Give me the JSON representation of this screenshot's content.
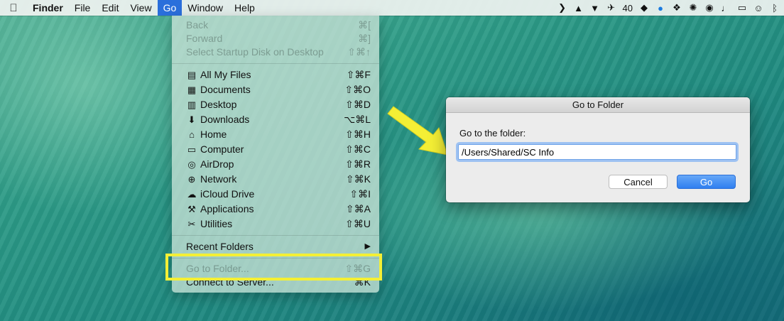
{
  "menubar": {
    "app_name": "Finder",
    "items": [
      "File",
      "Edit",
      "View",
      "Go",
      "Window",
      "Help"
    ],
    "active_item": "Go",
    "status_badge": "40"
  },
  "go_menu": {
    "nav_items": [
      {
        "label": "Back",
        "shortcut": "⌘[",
        "enabled": false
      },
      {
        "label": "Forward",
        "shortcut": "⌘]",
        "enabled": false
      },
      {
        "label": "Select Startup Disk on Desktop",
        "shortcut": "⇧⌘↑",
        "enabled": false
      }
    ],
    "location_items": [
      {
        "label": "All My Files",
        "shortcut": "⇧⌘F",
        "icon": "files-icon"
      },
      {
        "label": "Documents",
        "shortcut": "⇧⌘O",
        "icon": "documents-icon"
      },
      {
        "label": "Desktop",
        "shortcut": "⇧⌘D",
        "icon": "desktop-icon"
      },
      {
        "label": "Downloads",
        "shortcut": "⌥⌘L",
        "icon": "downloads-icon"
      },
      {
        "label": "Home",
        "shortcut": "⇧⌘H",
        "icon": "home-icon"
      },
      {
        "label": "Computer",
        "shortcut": "⇧⌘C",
        "icon": "computer-icon"
      },
      {
        "label": "AirDrop",
        "shortcut": "⇧⌘R",
        "icon": "airdrop-icon"
      },
      {
        "label": "Network",
        "shortcut": "⇧⌘K",
        "icon": "network-icon"
      },
      {
        "label": "iCloud Drive",
        "shortcut": "⇧⌘I",
        "icon": "cloud-icon"
      },
      {
        "label": "Applications",
        "shortcut": "⇧⌘A",
        "icon": "applications-icon"
      },
      {
        "label": "Utilities",
        "shortcut": "⇧⌘U",
        "icon": "utilities-icon"
      }
    ],
    "recent_folders": {
      "label": "Recent Folders",
      "submenu_glyph": "▶"
    },
    "go_to_folder": {
      "label": "Go to Folder...",
      "shortcut": "⇧⌘G",
      "enabled": false
    },
    "connect_to_server": {
      "label": "Connect to Server...",
      "shortcut": "⌘K"
    }
  },
  "dialog": {
    "title": "Go to Folder",
    "prompt": "Go to the folder:",
    "field_value": "/Users/Shared/SC Info",
    "cancel_label": "Cancel",
    "go_label": "Go"
  },
  "colors": {
    "highlight_box": "#f4ef35",
    "arrow": "#f4ef35",
    "menu_active": "#2a6fdb",
    "go_button": "#2f7ff0"
  }
}
